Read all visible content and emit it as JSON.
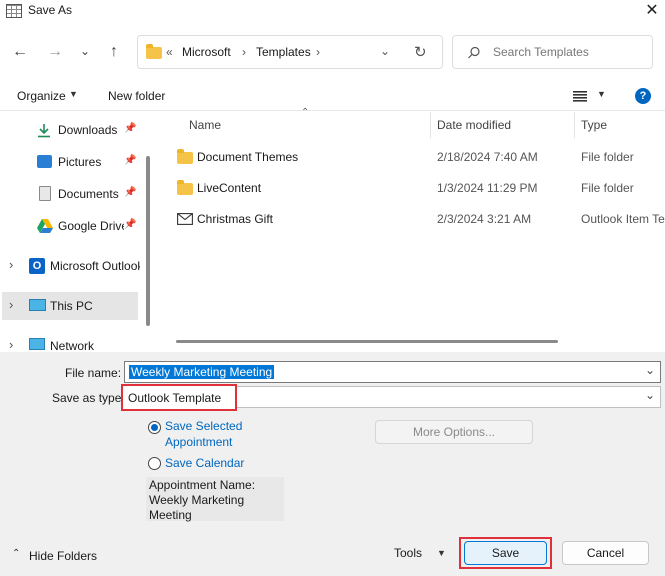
{
  "window": {
    "title": "Save As"
  },
  "nav": {
    "back": "←",
    "forward": "→",
    "recent": "⌄",
    "up": "↑"
  },
  "address": {
    "prefix": "«",
    "crumbs": [
      "Microsoft",
      "Templates"
    ]
  },
  "search": {
    "placeholder": "Search Templates"
  },
  "toolbar": {
    "organize": "Organize",
    "new_folder": "New folder"
  },
  "sidebar": {
    "items": [
      {
        "label": "Downloads",
        "icon": "download-icon",
        "pinned": true
      },
      {
        "label": "Pictures",
        "icon": "pictures-icon",
        "pinned": true
      },
      {
        "label": "Documents",
        "icon": "documents-icon",
        "pinned": true
      },
      {
        "label": "Google Drive",
        "icon": "google-drive-icon",
        "pinned": true
      },
      {
        "label": "Microsoft Outlook",
        "icon": "outlook-icon",
        "pinned": false
      },
      {
        "label": "This PC",
        "icon": "pc-icon",
        "pinned": false
      },
      {
        "label": "Network",
        "icon": "network-icon",
        "pinned": false
      }
    ]
  },
  "columns": {
    "name": "Name",
    "date": "Date modified",
    "type": "Type"
  },
  "files": [
    {
      "name": "Document Themes",
      "date": "2/18/2024 7:40 AM",
      "type": "File folder",
      "icon": "folder-icon"
    },
    {
      "name": "LiveContent",
      "date": "1/3/2024 11:29 PM",
      "type": "File folder",
      "icon": "folder-icon"
    },
    {
      "name": "Christmas Gift",
      "date": "2/3/2024 3:21 AM",
      "type": "Outlook Item Te",
      "icon": "mail-icon"
    }
  ],
  "form": {
    "file_name_label": "File name:",
    "file_name_value": "Weekly Marketing Meeting",
    "save_type_label": "Save as type:",
    "save_type_value": "Outlook Template",
    "option_selected_line1": "Save Selected",
    "option_selected_line2": "Appointment",
    "option_calendar": "Save Calendar",
    "more_options": "More Options...",
    "info_line1": "Appointment Name:",
    "info_line2": "Weekly Marketing",
    "info_line3": "Meeting"
  },
  "footer": {
    "hide_folders": "Hide Folders",
    "tools": "Tools",
    "save": "Save",
    "cancel": "Cancel"
  },
  "colors": {
    "accent": "#0067c0",
    "highlight": "#e0303a",
    "selection": "#0078d7"
  }
}
